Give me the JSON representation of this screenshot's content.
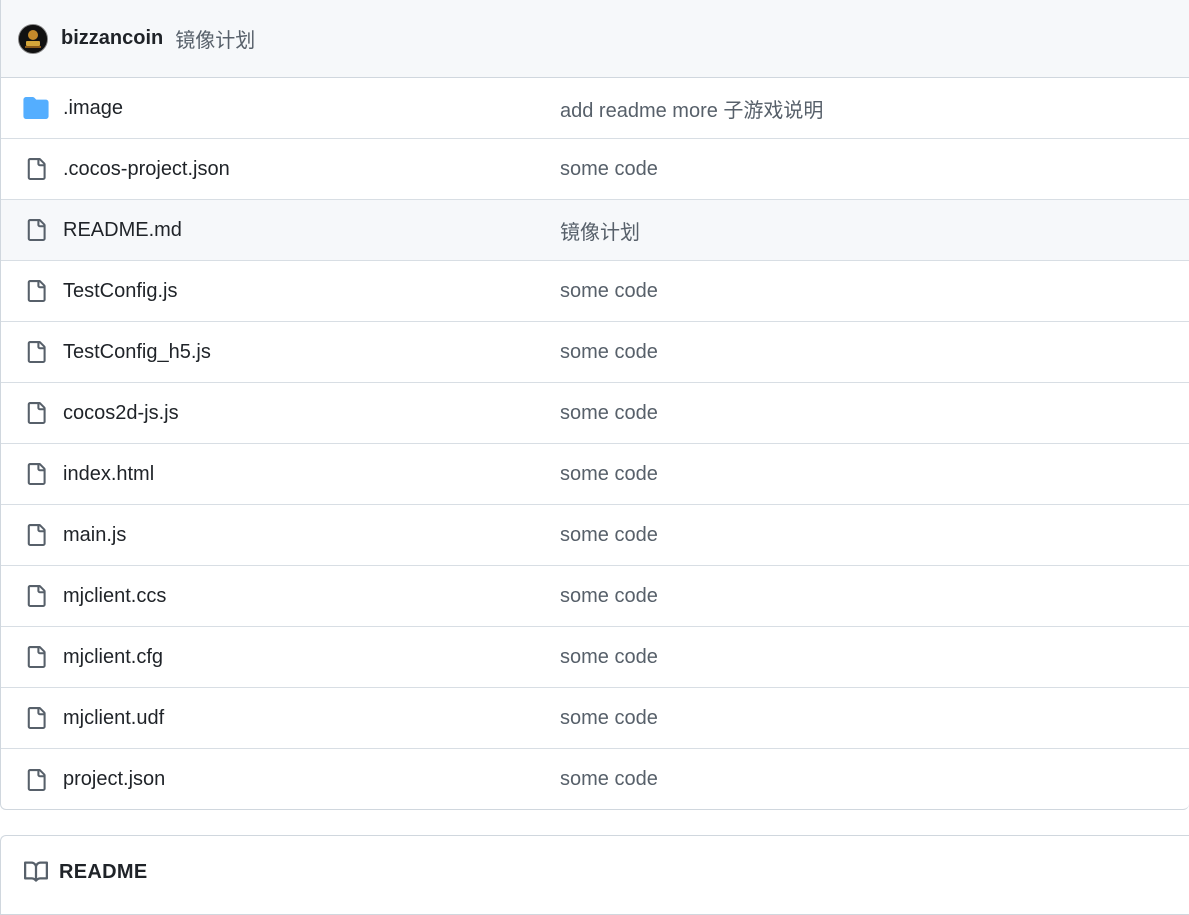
{
  "commit": {
    "author": "bizzancoin",
    "message": "镜像计划"
  },
  "files": [
    {
      "name": ".image",
      "type": "folder",
      "message": "add readme more 子游戏说明"
    },
    {
      "name": ".cocos-project.json",
      "type": "file",
      "message": "some code"
    },
    {
      "name": "README.md",
      "type": "file",
      "message": "镜像计划"
    },
    {
      "name": "TestConfig.js",
      "type": "file",
      "message": "some code"
    },
    {
      "name": "TestConfig_h5.js",
      "type": "file",
      "message": "some code"
    },
    {
      "name": "cocos2d-js.js",
      "type": "file",
      "message": "some code"
    },
    {
      "name": "index.html",
      "type": "file",
      "message": "some code"
    },
    {
      "name": "main.js",
      "type": "file",
      "message": "some code"
    },
    {
      "name": "mjclient.ccs",
      "type": "file",
      "message": "some code"
    },
    {
      "name": "mjclient.cfg",
      "type": "file",
      "message": "some code"
    },
    {
      "name": "mjclient.udf",
      "type": "file",
      "message": "some code"
    },
    {
      "name": "project.json",
      "type": "file",
      "message": "some code"
    }
  ],
  "readme": {
    "title": "README"
  },
  "colors": {
    "folder": "#54aeff",
    "file_icon": "#57606a",
    "border": "#d0d7de",
    "header_bg": "#f6f8fa"
  }
}
